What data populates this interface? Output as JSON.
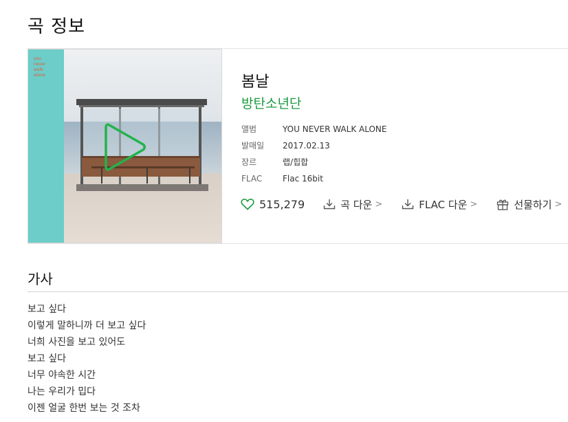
{
  "page": {
    "title": "곡 정보"
  },
  "song": {
    "cover_text": [
      "you",
      "never",
      "walk",
      "alone"
    ],
    "title": "봄날",
    "artist": "방탄소년단",
    "meta": [
      {
        "label": "앨범",
        "value": "YOU NEVER WALK ALONE"
      },
      {
        "label": "발매일",
        "value": "2017.02.13"
      },
      {
        "label": "장르",
        "value": "랩/힙합"
      },
      {
        "label": "FLAC",
        "value": "Flac 16bit"
      }
    ]
  },
  "actions": {
    "like_count": "515,279",
    "song_download": "곡 다운",
    "flac_download": "FLAC 다운",
    "gift": "선물하기",
    "chevron": ">"
  },
  "lyrics": {
    "title": "가사",
    "lines": [
      "보고 싶다",
      "이렇게 말하니까 더 보고 싶다",
      "너희 사진을 보고 있어도",
      "보고 싶다",
      "너무 야속한 시간",
      "나는 우리가 밉다",
      "이젠 얼굴 한번 보는 것 조차"
    ]
  },
  "colors": {
    "accent": "#1a9a3e",
    "cover_strip": "#6ccdc9",
    "cover_text": "#e55a3a"
  },
  "icons": [
    "play-icon",
    "heart-icon",
    "download-icon",
    "gift-icon"
  ]
}
